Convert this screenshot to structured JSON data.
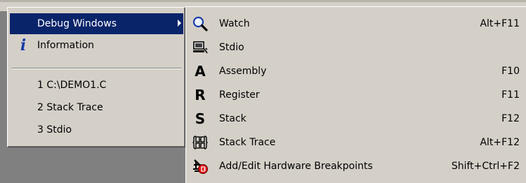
{
  "left_menu": {
    "items": [
      {
        "label": "Debug Windows"
      },
      {
        "label": "Information"
      },
      {
        "label": "1 C:\\DEMO1.C"
      },
      {
        "label": "2 Stack Trace"
      },
      {
        "label": "3 Stdio"
      }
    ]
  },
  "submenu": {
    "items": [
      {
        "label": "Watch",
        "shortcut": "Alt+F11",
        "icon": "magnifier-icon"
      },
      {
        "label": "Stdio",
        "shortcut": "",
        "icon": "console-icon"
      },
      {
        "label": "Assembly",
        "shortcut": "F10",
        "icon": "letter-a-icon",
        "glyph": "A"
      },
      {
        "label": "Register",
        "shortcut": "F11",
        "icon": "letter-r-icon",
        "glyph": "R"
      },
      {
        "label": "Stack",
        "shortcut": "F12",
        "icon": "letter-s-icon",
        "glyph": "S"
      },
      {
        "label": "Stack Trace",
        "shortcut": "Alt+F12",
        "icon": "stack-trace-icon"
      },
      {
        "label": "Add/Edit Hardware Breakpoints",
        "shortcut": "Shift+Ctrl+F2",
        "icon": "hardware-breakpoint-icon"
      }
    ]
  },
  "colors": {
    "menu_bg": "#d4d0c8",
    "highlight": "#0a246a",
    "desktop": "#808080"
  }
}
